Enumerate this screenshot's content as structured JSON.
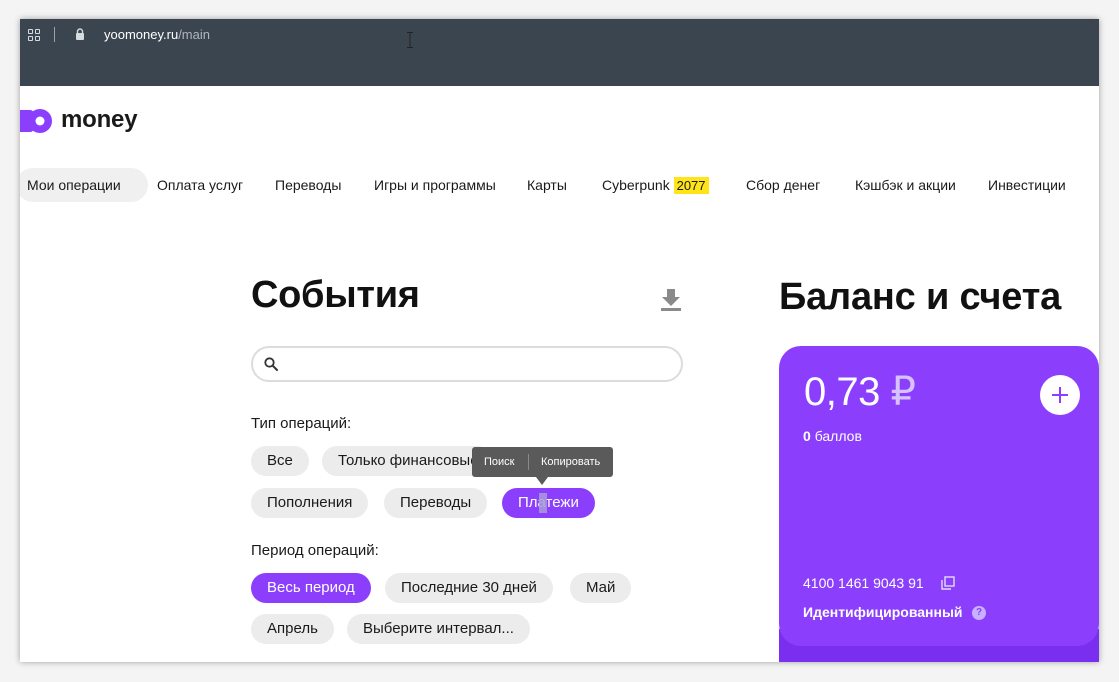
{
  "browser": {
    "url_domain": "yoomoney.ru",
    "url_path": "/main"
  },
  "brand": {
    "logo_text": "money",
    "accent_color": "#8b3ffd"
  },
  "nav": {
    "items": [
      {
        "label": "Мои операции",
        "active": true
      },
      {
        "label": "Оплата услуг"
      },
      {
        "label": "Переводы"
      },
      {
        "label": "Игры и программы"
      },
      {
        "label": "Карты"
      },
      {
        "label": "Cyberpunk",
        "badge": "2077"
      },
      {
        "label": "Сбор денег"
      },
      {
        "label": "Кэшбэк и акции"
      },
      {
        "label": "Инвестиции"
      }
    ]
  },
  "events": {
    "title": "События",
    "search_placeholder": "",
    "operation_type_label": "Тип операций:",
    "operation_types": [
      "Все",
      "Только финансовые",
      "Пополнения",
      "Переводы",
      "Платежи"
    ],
    "selected_type": "Платежи",
    "period_label": "Период операций:",
    "periods": [
      "Весь период",
      "Последние 30 дней",
      "Май",
      "Апрель",
      "Выберите интервал..."
    ],
    "selected_period": "Весь период"
  },
  "context_menu": {
    "items": [
      "Поиск",
      "Копировать"
    ]
  },
  "balance": {
    "title": "Баланс и счета",
    "amount": "0,73",
    "currency": "₽",
    "points_value": "0",
    "points_label": "баллов",
    "account_number": "4100 1461 9043 91",
    "status": "Идентифицированный"
  }
}
